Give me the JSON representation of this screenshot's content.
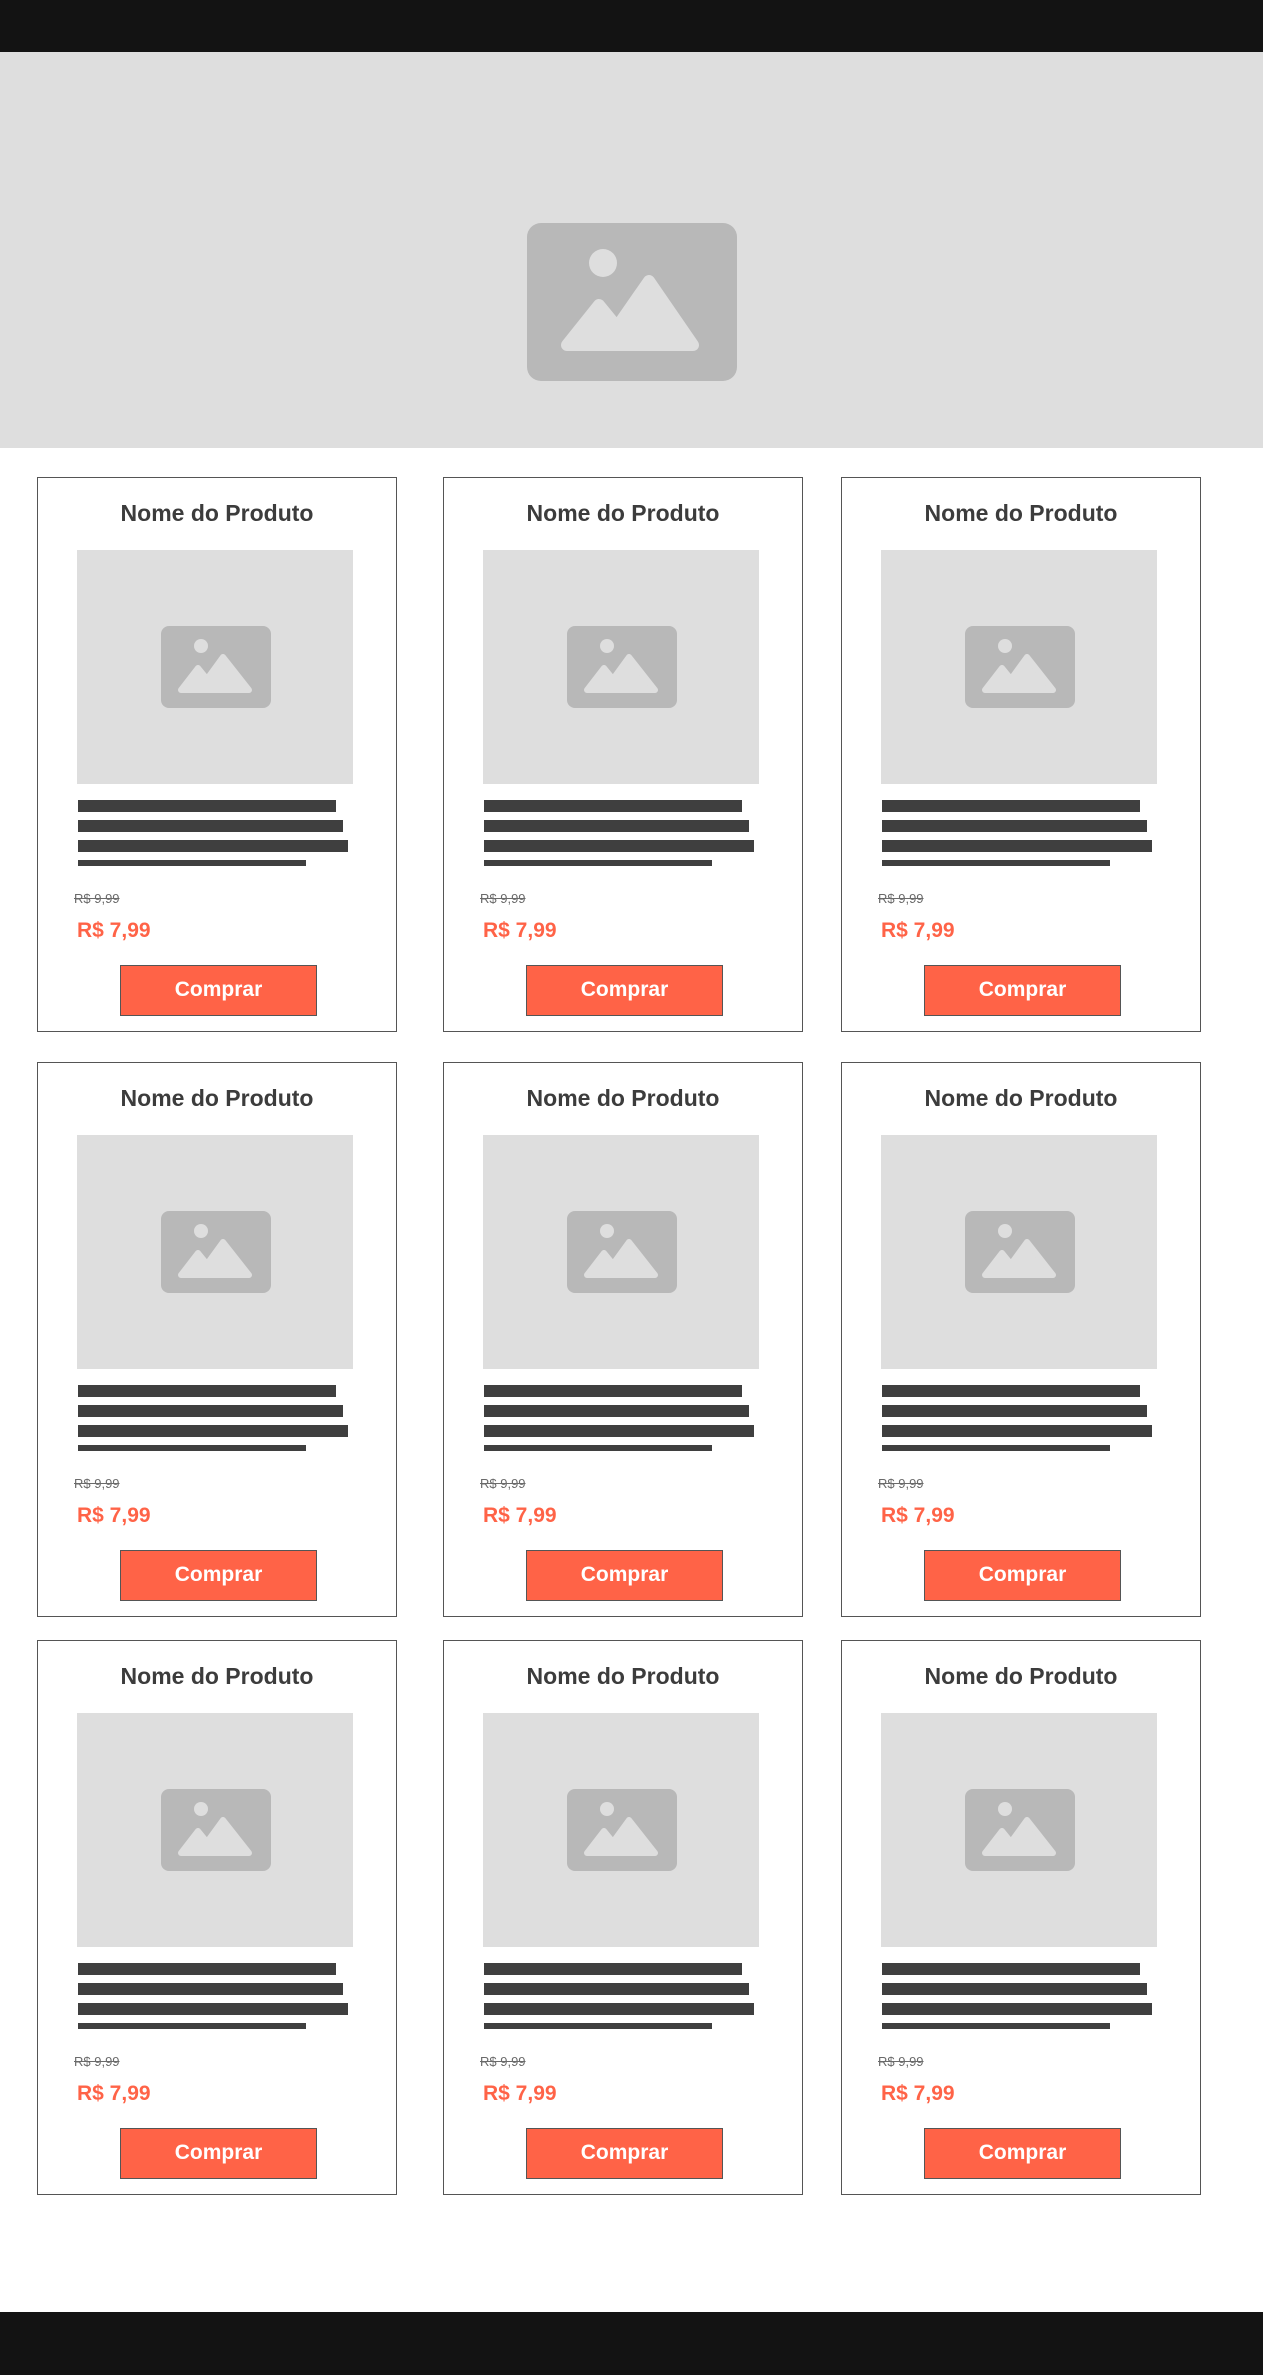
{
  "colors": {
    "bar": "#131313",
    "placeholder_bg": "#dedede",
    "placeholder_icon": "#b8b8b8",
    "accent": "#ff6347",
    "text_lines": "#3f3f3f"
  },
  "hero": {
    "icon": "image-placeholder-icon"
  },
  "products": [
    {
      "name": "Nome do Produto",
      "old_price": "R$ 9,99",
      "price": "R$ 7,99",
      "button": "Comprar"
    },
    {
      "name": "Nome do Produto",
      "old_price": "R$ 9,99",
      "price": "R$ 7,99",
      "button": "Comprar"
    },
    {
      "name": "Nome do Produto",
      "old_price": "R$ 9,99",
      "price": "R$ 7,99",
      "button": "Comprar"
    },
    {
      "name": "Nome do Produto",
      "old_price": "R$ 9,99",
      "price": "R$ 7,99",
      "button": "Comprar"
    },
    {
      "name": "Nome do Produto",
      "old_price": "R$ 9,99",
      "price": "R$ 7,99",
      "button": "Comprar"
    },
    {
      "name": "Nome do Produto",
      "old_price": "R$ 9,99",
      "price": "R$ 7,99",
      "button": "Comprar"
    },
    {
      "name": "Nome do Produto",
      "old_price": "R$ 9,99",
      "price": "R$ 7,99",
      "button": "Comprar"
    },
    {
      "name": "Nome do Produto",
      "old_price": "R$ 9,99",
      "price": "R$ 7,99",
      "button": "Comprar"
    },
    {
      "name": "Nome do Produto",
      "old_price": "R$ 9,99",
      "price": "R$ 7,99",
      "button": "Comprar"
    }
  ]
}
